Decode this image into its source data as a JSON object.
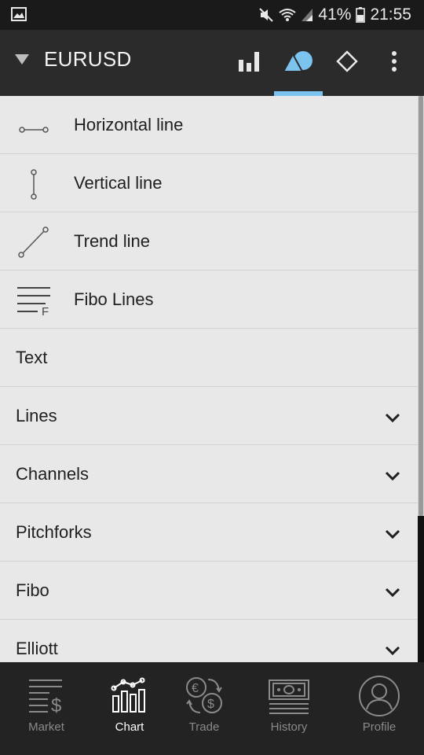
{
  "status_bar": {
    "battery": "41%",
    "time": "21:55"
  },
  "header": {
    "symbol": "EURUSD",
    "icons": [
      "indicators-icon",
      "objects-icon",
      "templates-icon",
      "more-icon"
    ],
    "accent": "#7dc3f0"
  },
  "objects": [
    {
      "label": "Horizontal line",
      "icon": "horizontal-line-icon"
    },
    {
      "label": "Vertical line",
      "icon": "vertical-line-icon"
    },
    {
      "label": "Trend line",
      "icon": "trend-line-icon"
    },
    {
      "label": "Fibo Lines",
      "icon": "fibo-lines-icon"
    }
  ],
  "text_item": {
    "label": "Text"
  },
  "groups": [
    {
      "label": "Lines"
    },
    {
      "label": "Channels"
    },
    {
      "label": "Pitchforks"
    },
    {
      "label": "Fibo"
    },
    {
      "label": "Elliott"
    }
  ],
  "bottom_nav": [
    {
      "label": "Market",
      "icon": "market-icon",
      "active": false
    },
    {
      "label": "Chart",
      "icon": "chart-icon",
      "active": true
    },
    {
      "label": "Trade",
      "icon": "trade-icon",
      "active": false
    },
    {
      "label": "History",
      "icon": "history-icon",
      "active": false
    },
    {
      "label": "Profile",
      "icon": "profile-icon",
      "active": false
    }
  ]
}
